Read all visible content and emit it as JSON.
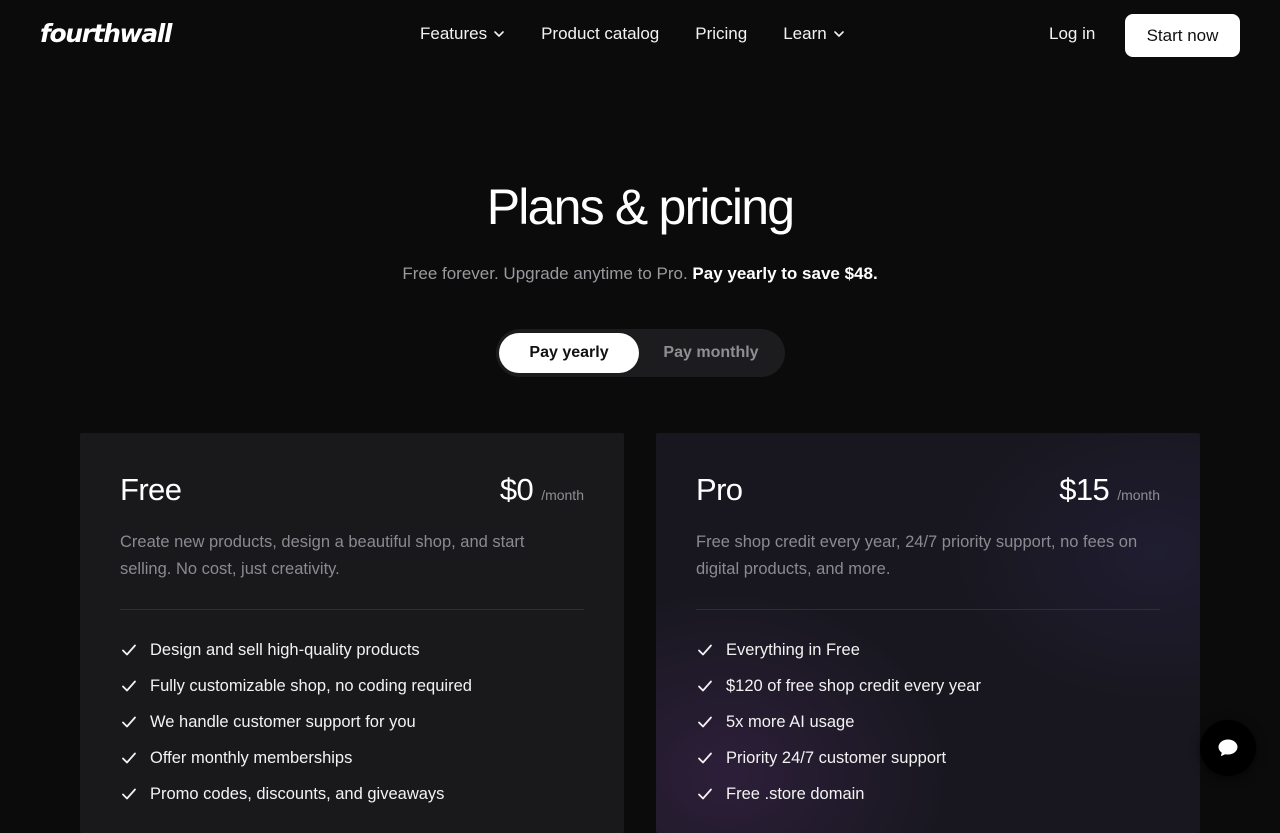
{
  "header": {
    "logo": "fourthwall",
    "nav": [
      {
        "label": "Features",
        "has_dropdown": true
      },
      {
        "label": "Product catalog",
        "has_dropdown": false
      },
      {
        "label": "Pricing",
        "has_dropdown": false
      },
      {
        "label": "Learn",
        "has_dropdown": true
      }
    ],
    "login_label": "Log in",
    "start_label": "Start now"
  },
  "hero": {
    "title": "Plans & pricing",
    "subtitle": "Free forever. Upgrade anytime to Pro.",
    "subtitle_bold": "Pay yearly to save $48."
  },
  "billing_toggle": {
    "options": [
      "Pay yearly",
      "Pay monthly"
    ],
    "selected": "Pay yearly"
  },
  "plans": [
    {
      "name": "Free",
      "price": "$0",
      "period": "/month",
      "description": "Create new products, design a beautiful shop, and start selling. No cost, just creativity.",
      "features": [
        "Design and sell high-quality products",
        "Fully customizable shop, no coding required",
        "We handle customer support for you",
        "Offer monthly memberships",
        "Promo codes, discounts, and giveaways"
      ]
    },
    {
      "name": "Pro",
      "price": "$15",
      "period": "/month",
      "description": "Free shop credit every year, 24/7 priority support, no fees on digital products, and more.",
      "features": [
        "Everything in Free",
        "$120 of free shop credit every year",
        "5x more AI usage",
        "Priority 24/7 customer support",
        "Free .store domain"
      ]
    }
  ],
  "icons": {
    "nav_dropdown": "chevron-down-icon",
    "feature": "check-icon",
    "chat": "chat-bubble-icon"
  },
  "colors": {
    "background": "#0b0b0c",
    "card": "#19191c",
    "toggle_track": "#1c1c1f",
    "muted_text": "#8a8a90",
    "accent_button": "#ffffff"
  }
}
